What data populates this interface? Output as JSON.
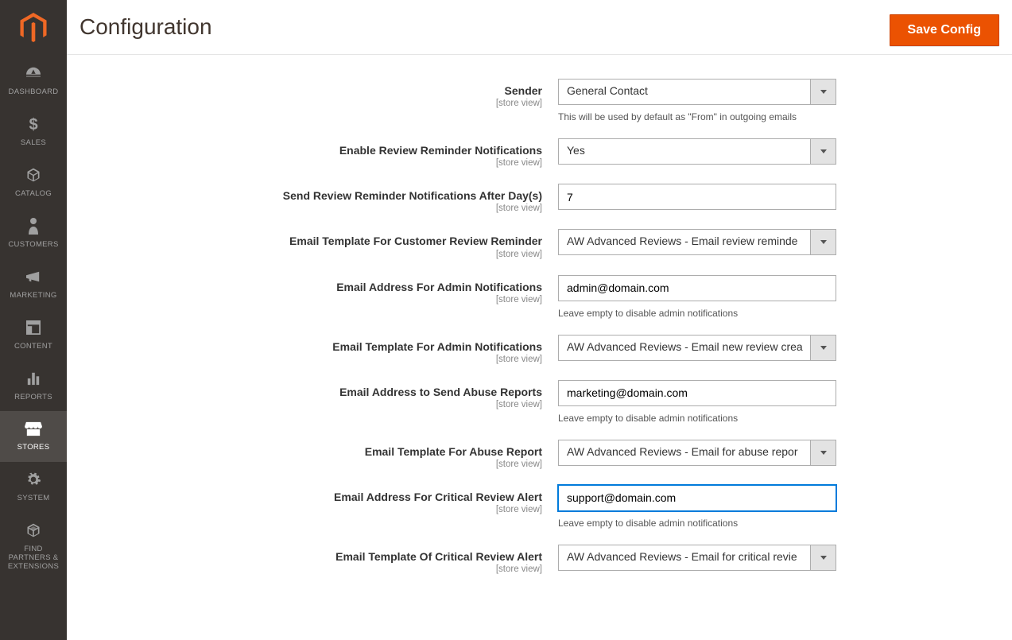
{
  "page": {
    "title": "Configuration"
  },
  "header": {
    "save_label": "Save Config"
  },
  "sidebar": {
    "items": [
      {
        "label": "DASHBOARD"
      },
      {
        "label": "SALES"
      },
      {
        "label": "CATALOG"
      },
      {
        "label": "CUSTOMERS"
      },
      {
        "label": "MARKETING"
      },
      {
        "label": "CONTENT"
      },
      {
        "label": "REPORTS"
      },
      {
        "label": "STORES"
      },
      {
        "label": "SYSTEM"
      },
      {
        "label": "FIND PARTNERS & EXTENSIONS"
      }
    ],
    "active_index": 7
  },
  "scope_text": "[store view]",
  "fields": {
    "sender": {
      "label": "Sender",
      "value": "General Contact",
      "hint": "This will be used by default as \"From\" in outgoing emails"
    },
    "enable_reminder": {
      "label": "Enable Review Reminder Notifications",
      "value": "Yes"
    },
    "reminder_days": {
      "label": "Send Review Reminder Notifications After Day(s)",
      "value": "7"
    },
    "tpl_customer_reminder": {
      "label": "Email Template For Customer Review Reminder",
      "value": "AW Advanced Reviews - Email review reminde"
    },
    "admin_email": {
      "label": "Email Address For Admin Notifications",
      "value": "admin@domain.com",
      "hint": "Leave empty to disable admin notifications"
    },
    "tpl_admin": {
      "label": "Email Template For Admin Notifications",
      "value": "AW Advanced Reviews - Email new review crea"
    },
    "abuse_email": {
      "label": "Email Address to Send Abuse Reports",
      "value": "marketing@domain.com",
      "hint": "Leave empty to disable admin notifications"
    },
    "tpl_abuse": {
      "label": "Email Template For Abuse Report",
      "value": "AW Advanced Reviews - Email for abuse repor"
    },
    "critical_email": {
      "label": "Email Address For Critical Review Alert",
      "value": "support@domain.com",
      "hint": "Leave empty to disable admin notifications"
    },
    "tpl_critical": {
      "label": "Email Template Of Critical Review Alert",
      "value": "AW Advanced Reviews - Email for critical revie"
    }
  }
}
